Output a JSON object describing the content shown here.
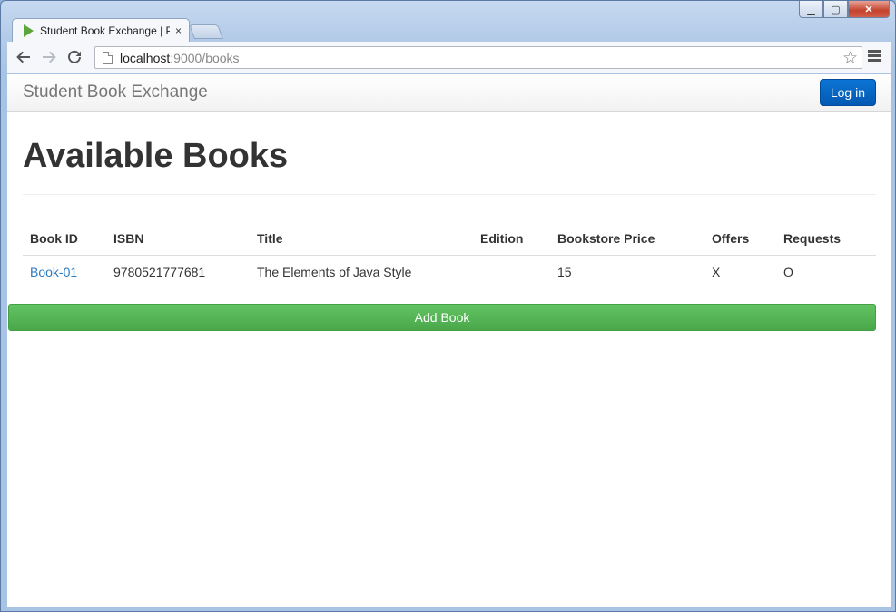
{
  "browser": {
    "tab_title": "Student Book Exchange | P",
    "tab_close": "×",
    "url_host": "localhost",
    "url_rest": ":9000/books",
    "window_controls": {
      "minimize": "▁",
      "maximize": "▢",
      "close": "✕"
    }
  },
  "navbar": {
    "brand": "Student Book Exchange",
    "login_label": "Log in"
  },
  "page": {
    "title": "Available Books",
    "table": {
      "headers": [
        "Book ID",
        "ISBN",
        "Title",
        "Edition",
        "Bookstore Price",
        "Offers",
        "Requests"
      ],
      "rows": [
        {
          "book_id": "Book-01",
          "isbn": "9780521777681",
          "title": "The Elements of Java Style",
          "edition": "",
          "price": "15",
          "offers": "X",
          "requests": "O"
        }
      ]
    },
    "add_button_label": "Add Book"
  },
  "colors": {
    "primary_button": "#0459b3",
    "success_button": "#4aa74a",
    "link": "#2a7ac0"
  }
}
